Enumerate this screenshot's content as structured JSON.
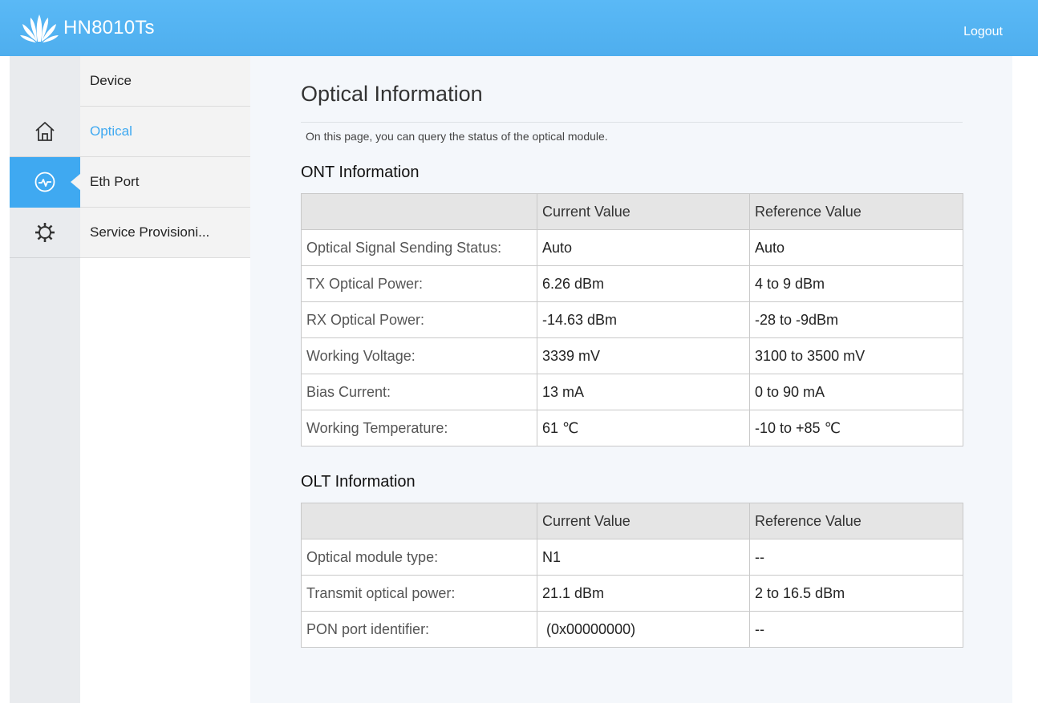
{
  "header": {
    "brand": "HN8010Ts",
    "logout_label": "Logout",
    "accent_color": "#4eaeee"
  },
  "rail": {
    "icons": [
      "home-icon",
      "pulse-icon",
      "gear-icon"
    ],
    "active": "pulse-icon"
  },
  "menu": {
    "items": [
      {
        "label": "Device"
      },
      {
        "label": "Optical"
      },
      {
        "label": "Eth Port"
      },
      {
        "label": "Service Provisioni..."
      }
    ],
    "active_index": 1
  },
  "page": {
    "title": "Optical Information",
    "description": "On this page, you can query the status of the optical module."
  },
  "ont": {
    "title": "ONT Information",
    "headers": [
      "",
      "Current Value",
      "Reference Value"
    ],
    "rows": [
      {
        "label": "Optical Signal Sending Status:",
        "current": "Auto",
        "reference": "Auto"
      },
      {
        "label": "TX Optical Power:",
        "current": "6.26 dBm",
        "reference": "4 to 9 dBm"
      },
      {
        "label": "RX Optical Power:",
        "current": "-14.63 dBm",
        "reference": "-28 to -9dBm"
      },
      {
        "label": "Working Voltage:",
        "current": "3339 mV",
        "reference": "3100 to 3500 mV"
      },
      {
        "label": "Bias Current:",
        "current": "13 mA",
        "reference": "0 to 90 mA"
      },
      {
        "label": "Working Temperature:",
        "current": "61 ℃",
        "reference": "-10 to +85 ℃"
      }
    ]
  },
  "olt": {
    "title": "OLT Information",
    "headers": [
      "",
      "Current Value",
      "Reference Value"
    ],
    "rows": [
      {
        "label": "Optical module type:",
        "current": "N1",
        "reference": "--"
      },
      {
        "label": "Transmit optical power:",
        "current": "21.1 dBm",
        "reference": "2 to 16.5 dBm"
      },
      {
        "label": "PON port identifier:",
        "current": " (0x00000000)",
        "reference": "--"
      }
    ]
  }
}
